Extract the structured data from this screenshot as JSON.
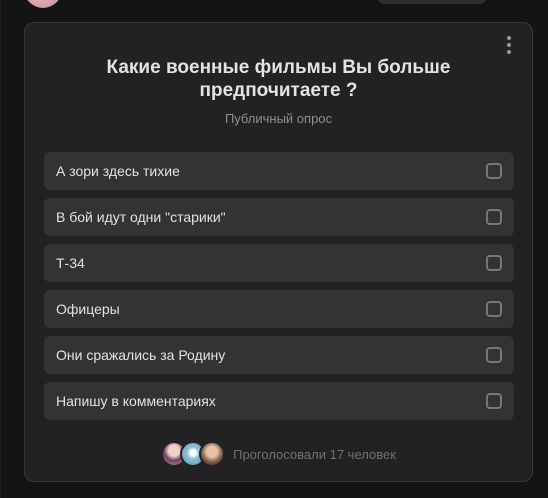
{
  "poll": {
    "question": "Какие военные фильмы Вы больше предпочитаете ?",
    "type_label": "Публичный опрос",
    "options": [
      {
        "label": "А зори здесь тихие",
        "checked": false
      },
      {
        "label": "В бой идут одни \"старики\"",
        "checked": false
      },
      {
        "label": "Т-34",
        "checked": false
      },
      {
        "label": "Офицеры",
        "checked": false
      },
      {
        "label": "Они сражались за Родину",
        "checked": false
      },
      {
        "label": "Напишу в комментариях",
        "checked": false
      }
    ],
    "voters_text": "Проголосовали 17 человек",
    "menu_icon": "more-vertical-icon"
  },
  "colors": {
    "background": "#141414",
    "card": "#222222",
    "option": "#333333",
    "text_primary": "#e1e3e6",
    "text_secondary": "#8d8f93"
  }
}
